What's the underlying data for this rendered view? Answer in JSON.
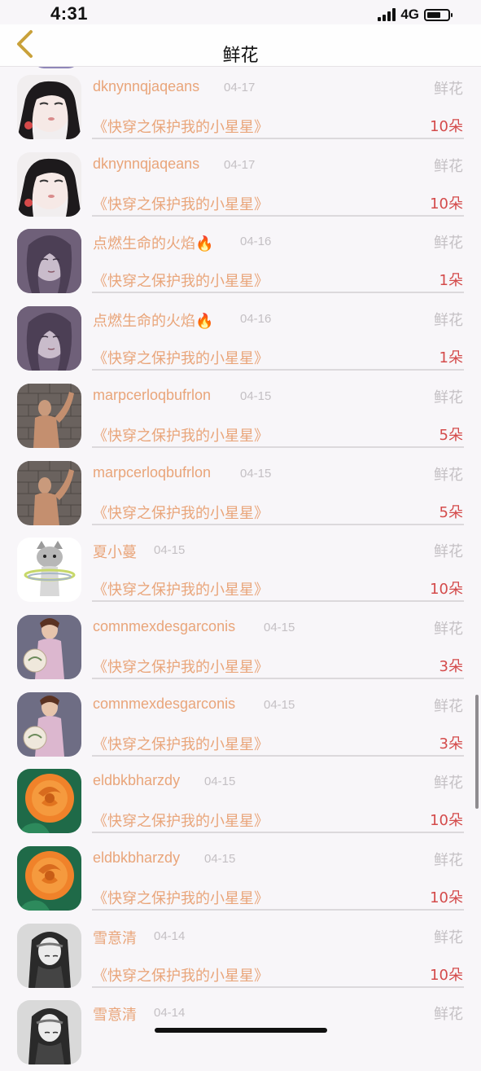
{
  "status_bar": {
    "time": "4:31",
    "network": "4G",
    "battery_level": 0.65
  },
  "nav": {
    "title": "鲜花",
    "back_icon": "chevron-left-icon"
  },
  "colors": {
    "accent": "#e9a57a",
    "muted": "#c4c0c4",
    "amount": "#d44b4b",
    "background": "#f8f6f9"
  },
  "records": [
    {
      "user": "dknynnqjaqeans",
      "date": "04-17",
      "kind": "鲜花",
      "book": "《快穿之保护我的小星星》",
      "amount": "10朵",
      "avatar": "portrait-girl-icon"
    },
    {
      "user": "dknynnqjaqeans",
      "date": "04-17",
      "kind": "鲜花",
      "book": "《快穿之保护我的小星星》",
      "amount": "10朵",
      "avatar": "portrait-girl-icon"
    },
    {
      "user": "点燃生命的火焰🔥",
      "date": "04-16",
      "kind": "鲜花",
      "book": "《快穿之保护我的小星星》",
      "amount": "1朵",
      "avatar": "sketch-girl-icon"
    },
    {
      "user": "点燃生命的火焰🔥",
      "date": "04-16",
      "kind": "鲜花",
      "book": "《快穿之保护我的小星星》",
      "amount": "1朵",
      "avatar": "sketch-girl-icon"
    },
    {
      "user": "marpcerloqbufrlon",
      "date": "04-15",
      "kind": "鲜花",
      "book": "《快穿之保护我的小星星》",
      "amount": "5朵",
      "avatar": "man-wall-icon"
    },
    {
      "user": "marpcerloqbufrlon",
      "date": "04-15",
      "kind": "鲜花",
      "book": "《快穿之保护我的小星星》",
      "amount": "5朵",
      "avatar": "man-wall-icon"
    },
    {
      "user": "夏小蔓",
      "date": "04-15",
      "kind": "鲜花",
      "book": "《快穿之保护我的小星星》",
      "amount": "10朵",
      "avatar": "cat-hula-icon"
    },
    {
      "user": "comnmexdesgarconis",
      "date": "04-15",
      "kind": "鲜花",
      "book": "《快穿之保护我的小星星》",
      "amount": "3朵",
      "avatar": "qipao-woman-icon"
    },
    {
      "user": "comnmexdesgarconis",
      "date": "04-15",
      "kind": "鲜花",
      "book": "《快穿之保护我的小星星》",
      "amount": "3朵",
      "avatar": "qipao-woman-icon"
    },
    {
      "user": "eldbkbharzdy",
      "date": "04-15",
      "kind": "鲜花",
      "book": "《快穿之保护我的小星星》",
      "amount": "10朵",
      "avatar": "orange-rose-icon"
    },
    {
      "user": "eldbkbharzdy",
      "date": "04-15",
      "kind": "鲜花",
      "book": "《快穿之保护我的小星星》",
      "amount": "10朵",
      "avatar": "orange-rose-icon"
    },
    {
      "user": "雪意清",
      "date": "04-14",
      "kind": "鲜花",
      "book": "《快穿之保护我的小星星》",
      "amount": "10朵",
      "avatar": "bw-woman-icon"
    },
    {
      "user": "雪意清",
      "date": "04-14",
      "kind": "鲜花",
      "book": "",
      "amount": "",
      "avatar": "bw-woman-icon"
    }
  ]
}
